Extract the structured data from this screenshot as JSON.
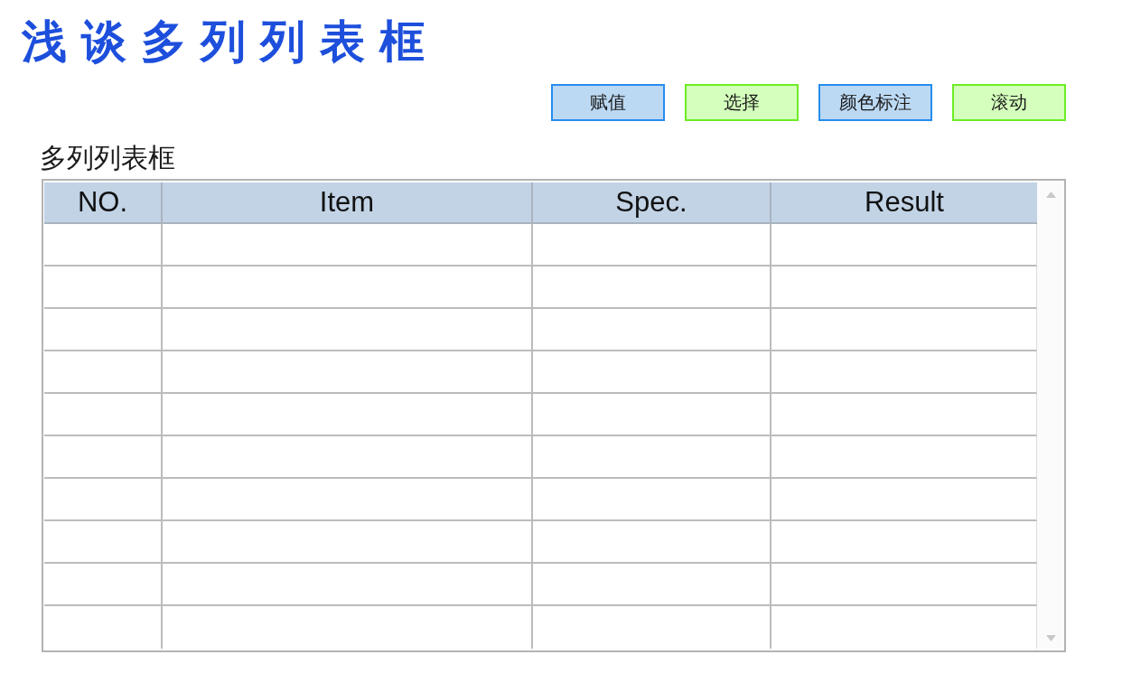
{
  "title": "浅谈多列列表框",
  "buttons": [
    {
      "label": "赋值",
      "color": "#bcd9f4"
    },
    {
      "label": "选择",
      "color": "#d4ffbc"
    },
    {
      "label": "颜色标注",
      "color": "#bcd9f4"
    },
    {
      "label": "滚动",
      "color": "#d4ffbc"
    }
  ],
  "listbox": {
    "label": "多列列表框",
    "columns": [
      "NO.",
      "Item",
      "Spec.",
      "Result"
    ],
    "rows": [
      {},
      {},
      {},
      {},
      {},
      {},
      {},
      {},
      {},
      {}
    ]
  }
}
